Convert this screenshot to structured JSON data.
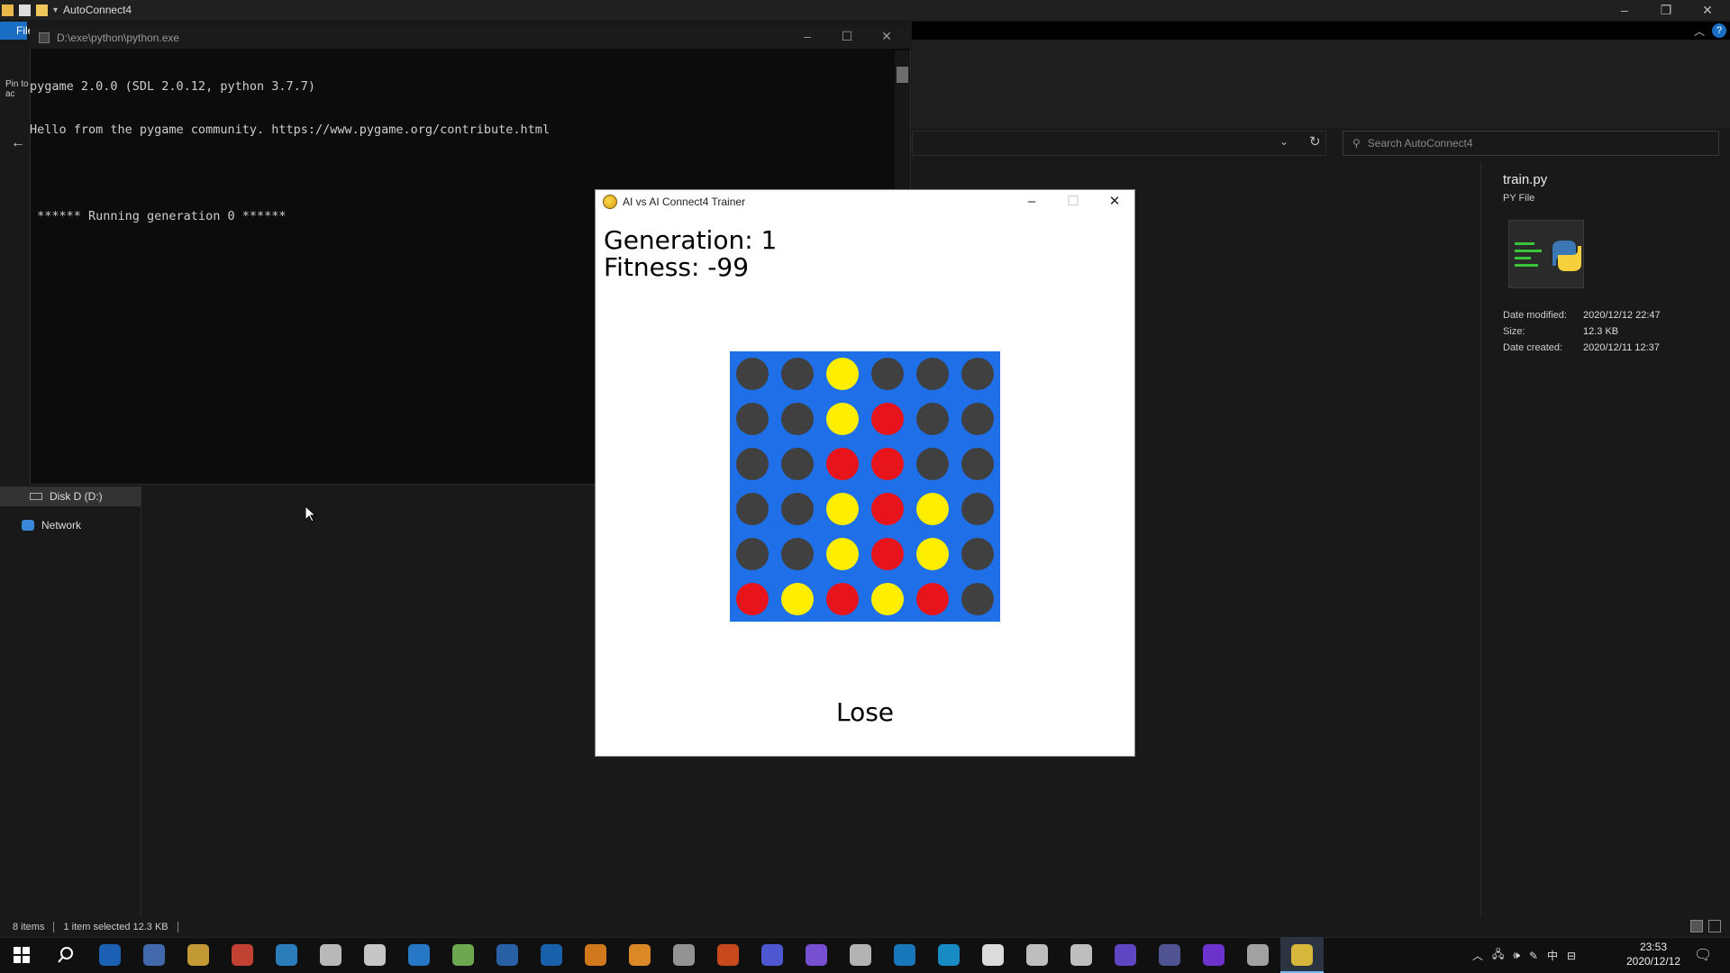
{
  "explorer": {
    "title": "AutoConnect4",
    "ribbon_tab": "File",
    "pin_text": "Pin to\nac",
    "search_placeholder": "Search AutoConnect4",
    "nav": [
      {
        "label": "Disk D (D:)",
        "icon": "drive-icon",
        "selected": true
      },
      {
        "label": "Network",
        "icon": "network-icon",
        "selected": false
      }
    ],
    "details": {
      "name": "train.py",
      "type": "PY File",
      "modified_label": "Date modified:",
      "modified_value": "2020/12/12 22:47",
      "size_label": "Size:",
      "size_value": "12.3 KB",
      "created_label": "Date created:",
      "created_value": "2020/12/11 12:37"
    },
    "status": {
      "items": "8 items",
      "selected": "1 item selected  12.3 KB"
    }
  },
  "console": {
    "title": "D:\\exe\\python\\python.exe",
    "lines": [
      "pygame 2.0.0 (SDL 2.0.12, python 3.7.7)",
      "Hello from the pygame community. https://www.pygame.org/contribute.html",
      "",
      " ****** Running generation 0 ******"
    ]
  },
  "game": {
    "title": "AI vs AI Connect4 Trainer",
    "generation": "Generation: 1",
    "fitness": "Fitness: -99",
    "result": "Lose",
    "colors": {
      "board": "#1e6fe8",
      "empty": "#404040",
      "yellow": "#ffee00",
      "red": "#e8141c"
    },
    "board": [
      [
        "E",
        "E",
        "Y",
        "E",
        "E",
        "E"
      ],
      [
        "E",
        "E",
        "Y",
        "R",
        "E",
        "E"
      ],
      [
        "E",
        "E",
        "R",
        "R",
        "E",
        "E"
      ],
      [
        "E",
        "E",
        "Y",
        "R",
        "Y",
        "E"
      ],
      [
        "E",
        "E",
        "Y",
        "R",
        "Y",
        "E"
      ],
      [
        "R",
        "Y",
        "R",
        "Y",
        "R",
        "E"
      ]
    ]
  },
  "taskbar": {
    "time": "23:53",
    "date": "2020/12/12",
    "ime": "中",
    "apps": [
      "start-icon",
      "search-icon",
      "task-view-icon",
      "calculator-icon",
      "file-explorer-icon",
      "chrome-icon",
      "xcode-icon",
      "steam-icon",
      "fox-icon",
      "vscode-icon",
      "notepad-icon",
      "save-icon",
      "app-icon",
      "vlc-icon",
      "sublime-icon",
      "app2-icon",
      "ubuntu-icon",
      "discord-icon",
      "app3-icon",
      "remote-desktop-icon",
      "store-icon",
      "skype-icon",
      "twitch-icon",
      "film-icon",
      "unity-icon",
      "eclipse-icon",
      "app4-icon",
      "app5-icon",
      "app6-icon",
      "python-icon"
    ]
  }
}
